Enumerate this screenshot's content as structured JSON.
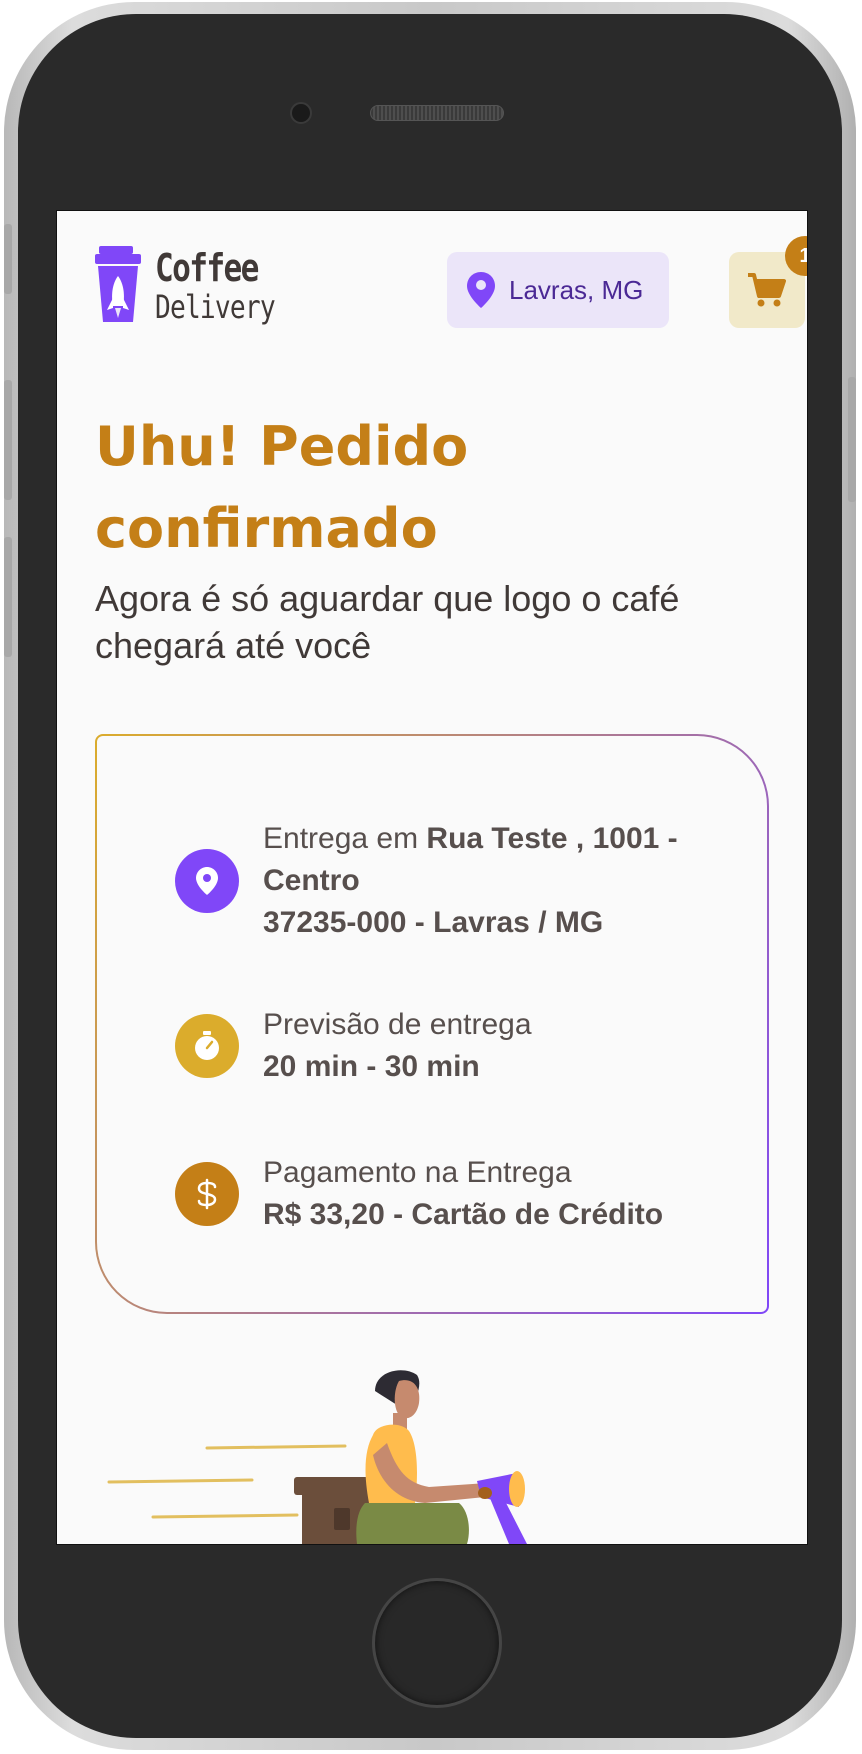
{
  "brand": {
    "line1": "Coffee",
    "line2": "Delivery",
    "purple": "#8047F8",
    "dark_purple": "#4B2995",
    "yellow_dark": "#C47F17",
    "yellow": "#DBAC2C"
  },
  "header": {
    "location_label": "Lavras, MG",
    "location_icon": "map-pin-icon",
    "cart_icon": "shopping-cart-icon",
    "cart_count": "1"
  },
  "page": {
    "title": "Uhu! Pedido confirmado",
    "subtitle": "Agora é só aguardar que logo o café chegará até você"
  },
  "order_info": {
    "delivery": {
      "icon": "map-pin-icon",
      "prefix": "Entrega em ",
      "street": "Rua Teste , 1001 - Centro",
      "city_line": "37235-000 - Lavras / MG"
    },
    "estimate": {
      "icon": "timer-icon",
      "label": "Previsão de entrega",
      "value": "20 min - 30 min"
    },
    "payment": {
      "icon": "currency-dollar-icon",
      "label": "Pagamento na Entrega",
      "value": "R$ 33,20 - Cartão de Crédito"
    }
  }
}
